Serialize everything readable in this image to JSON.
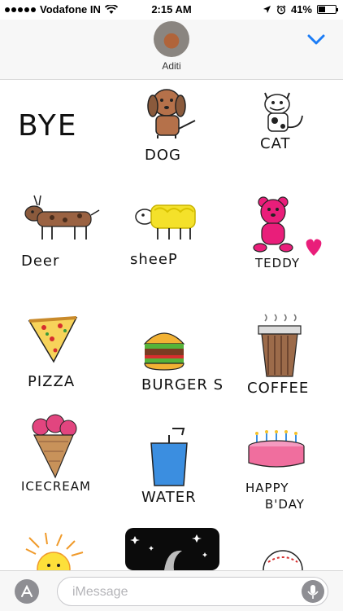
{
  "status_bar": {
    "carrier": "Vodafone IN",
    "time": "2:15 AM",
    "battery": "41%",
    "battery_level": 0.41
  },
  "header": {
    "contact_name": "Aditi"
  },
  "stickers": [
    {
      "name": "bye",
      "caption": "BYE"
    },
    {
      "name": "dog",
      "caption": "DOG"
    },
    {
      "name": "cat",
      "caption": "CAT"
    },
    {
      "name": "deer",
      "caption": "Deer"
    },
    {
      "name": "sheep",
      "caption": "sheeP"
    },
    {
      "name": "teddy",
      "caption": "TEDDY"
    },
    {
      "name": "pizza",
      "caption": "PIZZA"
    },
    {
      "name": "burgers",
      "caption": "BURGER S"
    },
    {
      "name": "coffee",
      "caption": "COFFEE"
    },
    {
      "name": "icecream",
      "caption": "ICECREAM"
    },
    {
      "name": "water",
      "caption": "WATER"
    },
    {
      "name": "happy-bday",
      "caption": "HAPPY",
      "caption2": "B'DAY"
    },
    {
      "name": "sun",
      "caption": ""
    },
    {
      "name": "night",
      "caption": ""
    },
    {
      "name": "baseball",
      "caption": ""
    }
  ],
  "input_bar": {
    "placeholder": "iMessage"
  },
  "colors": {
    "accent": "#1b7cf6",
    "header_bg": "#f7f7f7",
    "brown": "#8a5a3c",
    "pink": "#e91e7a",
    "yellow": "#f4e12a"
  },
  "icons": {
    "signal": "signal-dots-icon",
    "wifi": "wifi-icon",
    "location": "location-arrow-icon",
    "alarm": "alarm-icon",
    "battery": "battery-icon",
    "collapse": "chevron-down-icon",
    "apps": "app-store-icon",
    "mic": "microphone-icon"
  }
}
